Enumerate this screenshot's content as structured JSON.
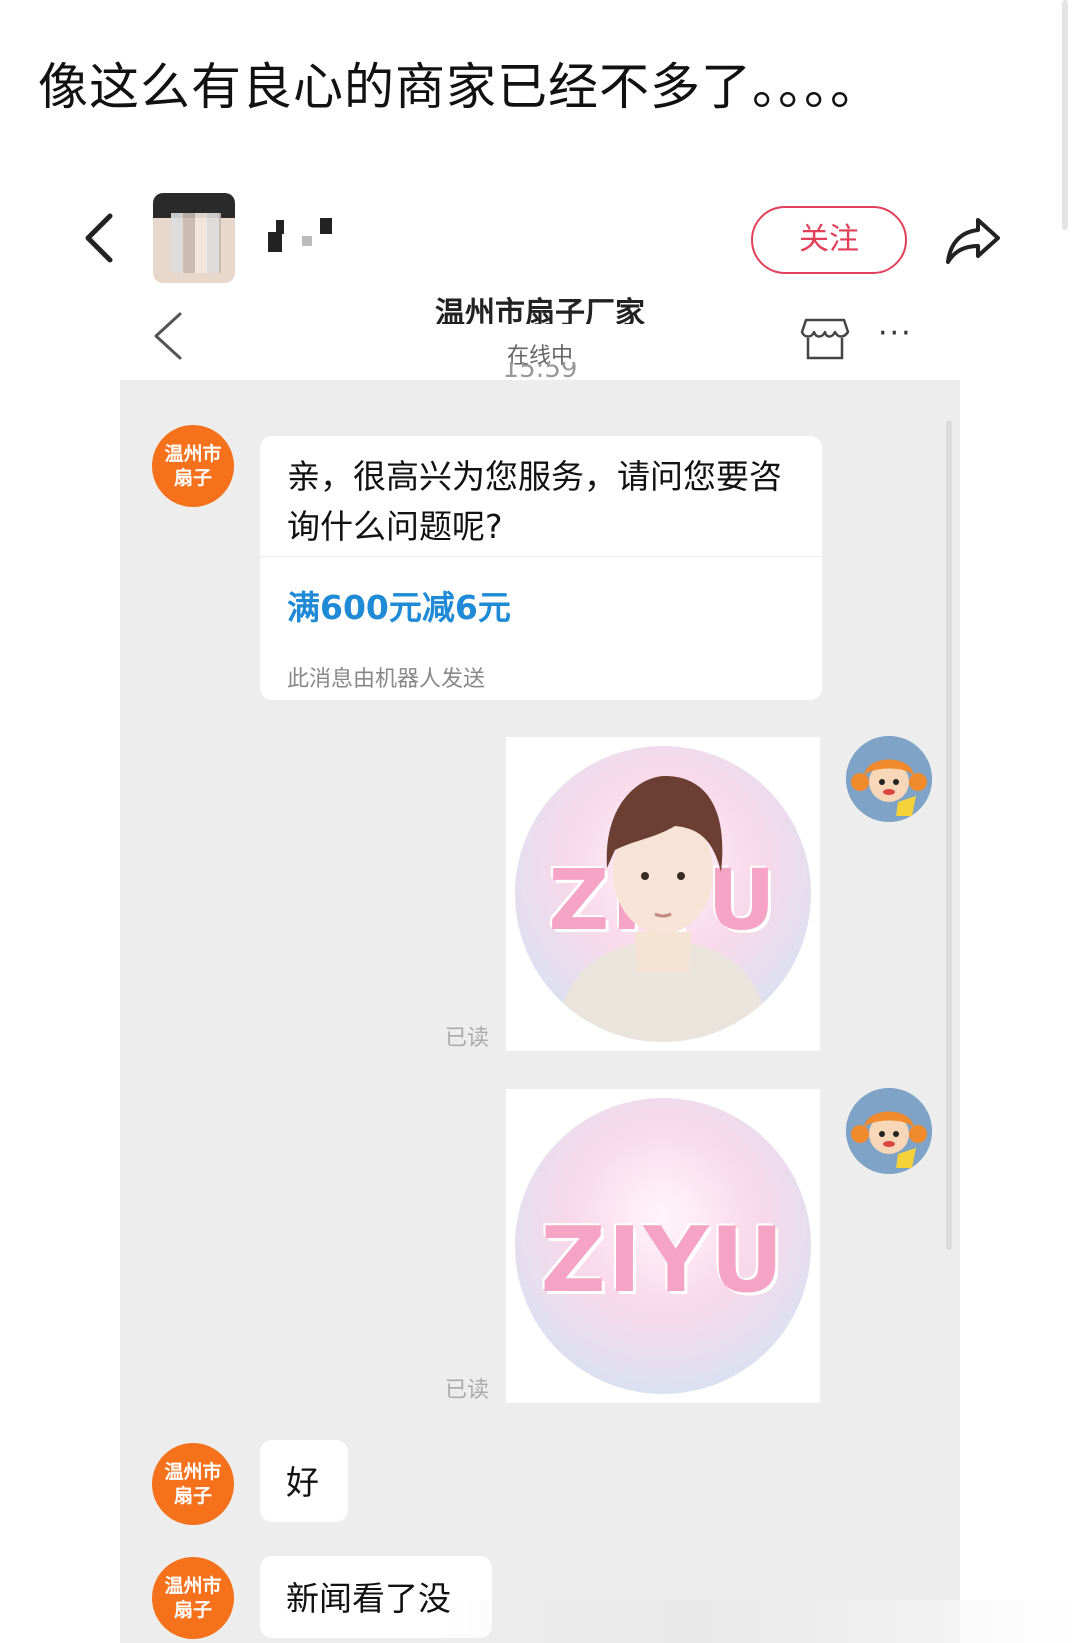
{
  "post": {
    "caption": "像这么有良心的商家已经不多了。。。。"
  },
  "outer_header": {
    "follow_label": "关注"
  },
  "chat": {
    "shop_name": "温州市扇子厂家",
    "status": "在线中",
    "time": "15:59",
    "seller_avatar_line1": "温州市",
    "seller_avatar_line2": "扇子",
    "messages": {
      "greeting": "亲，很高兴为您服务，请问您要咨询什么问题呢?",
      "promo": "满600元减6元",
      "robot_note": "此消息由机器人发送",
      "read_1": "已读",
      "read_2": "已读",
      "reply_ok": "好",
      "reply_news": "新闻看了没"
    },
    "image_logo_text": "ZIYU"
  },
  "colors": {
    "accent_red": "#e0405a",
    "promo_blue": "#1f8ad6",
    "seller_orange": "#f5711b",
    "chat_bg": "#ededed"
  }
}
